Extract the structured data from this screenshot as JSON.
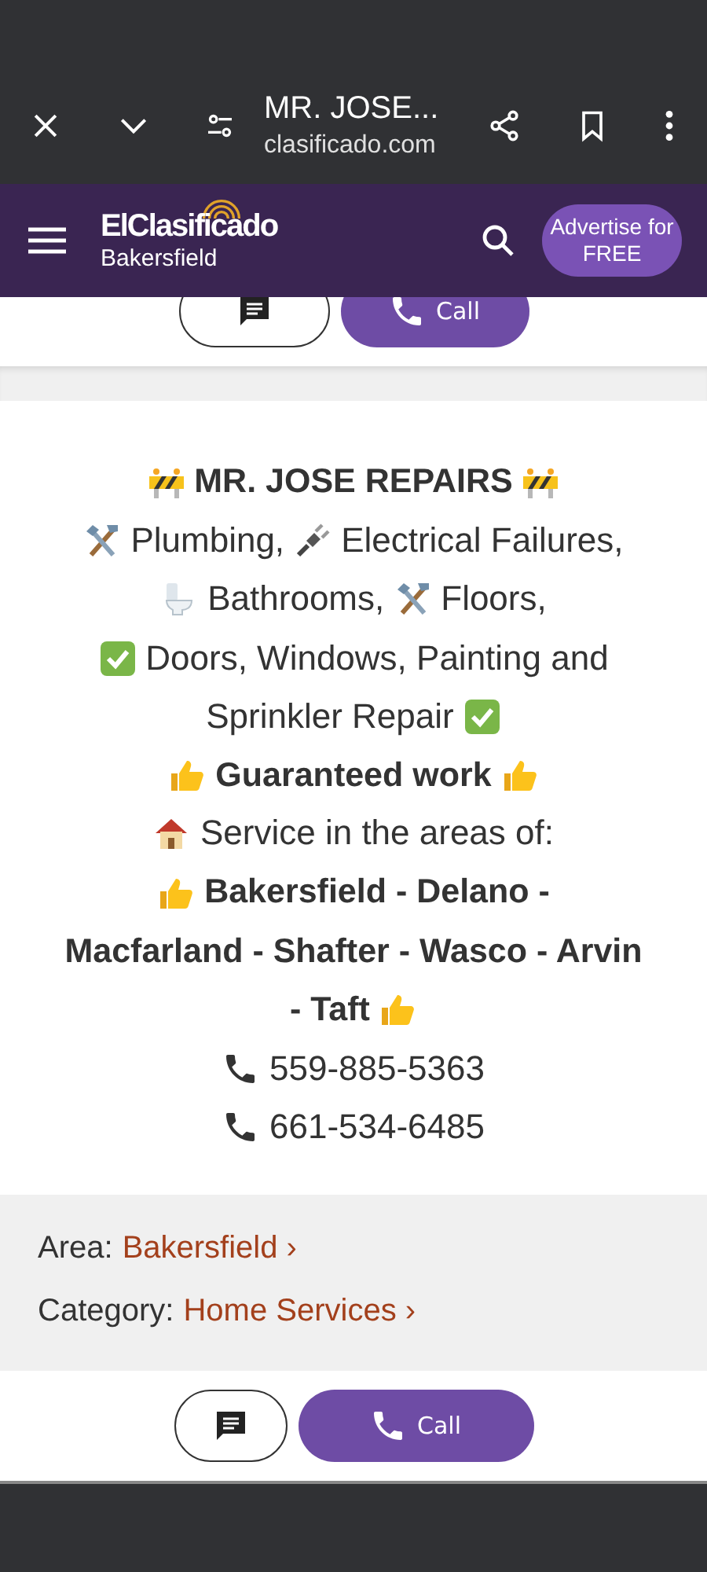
{
  "browser": {
    "title": "MR. JOSE...",
    "url": "clasificado.com"
  },
  "site_header": {
    "logo": "ElClasificado",
    "city": "Bakersfield",
    "advertise": "Advertise for FREE"
  },
  "top_actions": {
    "call": "Call"
  },
  "description": {
    "lines": [
      {
        "bold": true,
        "segments": [
          {
            "kind": "barrier"
          },
          {
            "kind": "text",
            "text": "MR. JOSE REPAIRS"
          },
          {
            "kind": "barrier"
          }
        ]
      },
      {
        "bold": false,
        "segments": [
          {
            "kind": "tools"
          },
          {
            "kind": "text",
            "text": "Plumbing,"
          },
          {
            "kind": "plug"
          },
          {
            "kind": "text",
            "text": "Electrical Failures,"
          }
        ]
      },
      {
        "bold": false,
        "segments": [
          {
            "kind": "toilet"
          },
          {
            "kind": "text",
            "text": "Bathrooms,"
          },
          {
            "kind": "tools"
          },
          {
            "kind": "text",
            "text": "Floors,"
          }
        ]
      },
      {
        "bold": false,
        "segments": [
          {
            "kind": "check"
          },
          {
            "kind": "text",
            "text": "Doors, Windows, Painting and"
          }
        ]
      },
      {
        "bold": false,
        "segments": [
          {
            "kind": "text",
            "text": "Sprinkler Repair"
          },
          {
            "kind": "check"
          }
        ]
      },
      {
        "bold": true,
        "segments": [
          {
            "kind": "thumb"
          },
          {
            "kind": "text",
            "text": "Guaranteed work"
          },
          {
            "kind": "thumb"
          }
        ]
      },
      {
        "bold": false,
        "segments": [
          {
            "kind": "house"
          },
          {
            "kind": "text",
            "text": "Service in the areas of:"
          }
        ]
      },
      {
        "bold": true,
        "segments": [
          {
            "kind": "thumb"
          },
          {
            "kind": "text",
            "text": "Bakersfield - Delano -"
          }
        ]
      },
      {
        "bold": true,
        "segments": [
          {
            "kind": "text",
            "text": "Macfarland - Shafter - Wasco - Arvin"
          }
        ]
      },
      {
        "bold": true,
        "segments": [
          {
            "kind": "text",
            "text": "- Taft"
          },
          {
            "kind": "thumb"
          }
        ]
      },
      {
        "bold": false,
        "segments": [
          {
            "kind": "phone"
          },
          {
            "kind": "text",
            "text": "559-885-5363"
          }
        ]
      },
      {
        "bold": false,
        "segments": [
          {
            "kind": "phone"
          },
          {
            "kind": "text",
            "text": "661-534-6485"
          }
        ]
      }
    ]
  },
  "info": [
    {
      "label": "Area:",
      "link": "Bakersfield ›"
    },
    {
      "label": "Category:",
      "link": "Home Services ›"
    }
  ],
  "bottom_actions": {
    "call": "Call"
  }
}
